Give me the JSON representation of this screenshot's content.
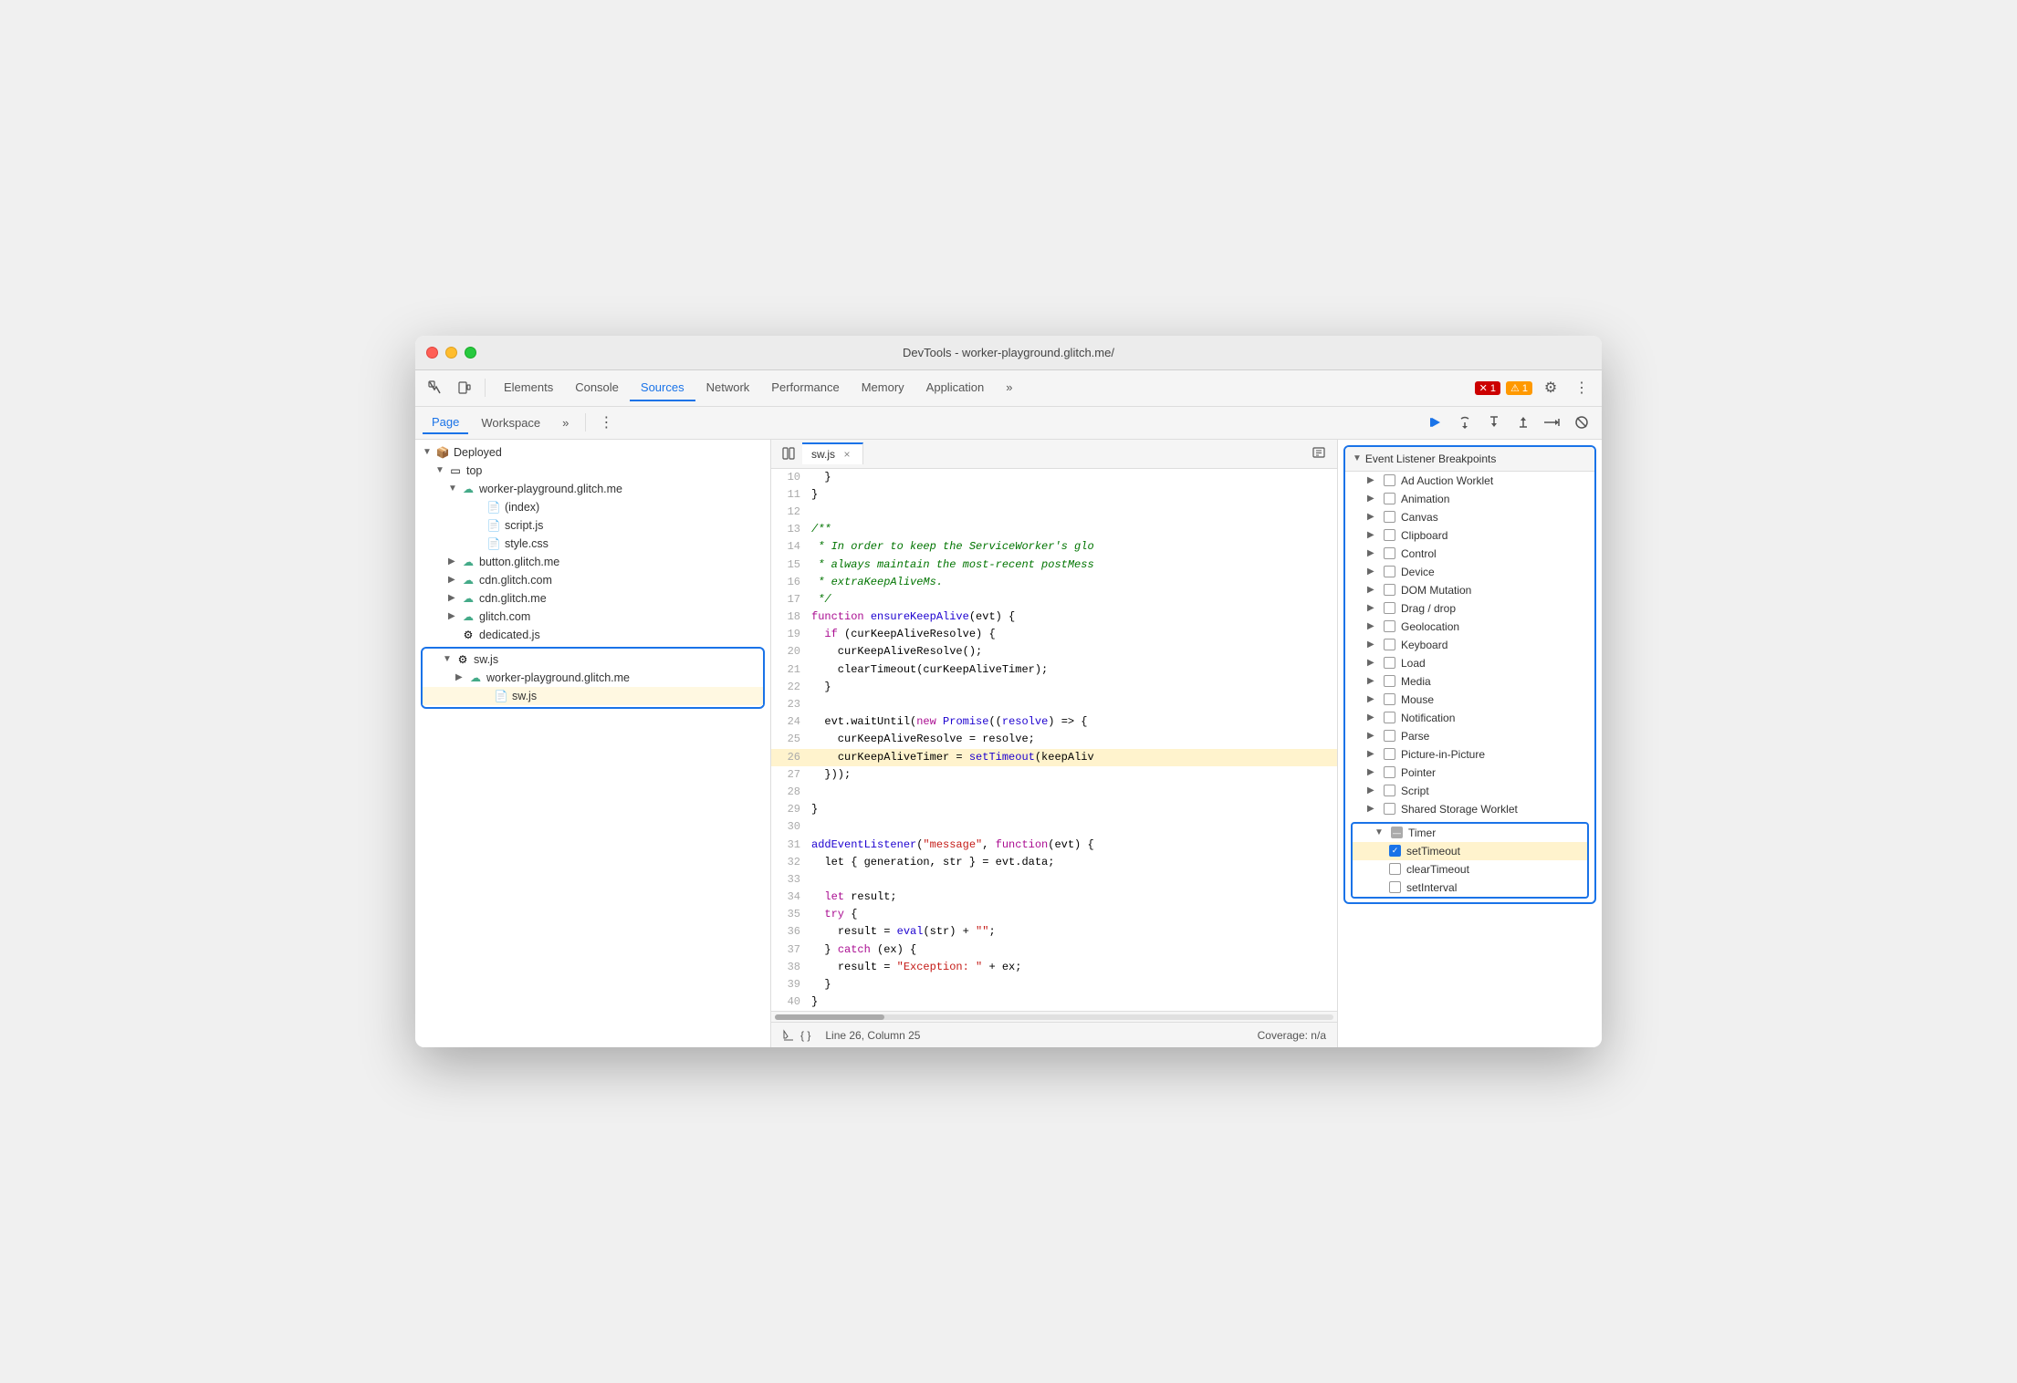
{
  "window": {
    "title": "DevTools - worker-playground.glitch.me/"
  },
  "toolbar": {
    "tabs": [
      {
        "label": "Elements",
        "active": false
      },
      {
        "label": "Console",
        "active": false
      },
      {
        "label": "Sources",
        "active": true
      },
      {
        "label": "Network",
        "active": false
      },
      {
        "label": "Performance",
        "active": false
      },
      {
        "label": "Memory",
        "active": false
      },
      {
        "label": "Application",
        "active": false
      },
      {
        "label": "»",
        "active": false
      }
    ],
    "error_badge": "✕ 1",
    "warn_badge": "⚠ 1",
    "settings_icon": "⚙",
    "more_icon": "⋮"
  },
  "subtoolbar": {
    "page_tab": "Page",
    "workspace_tab": "Workspace",
    "more": "»",
    "debug_icons": [
      "▶",
      "↺",
      "↓",
      "↑",
      "→→",
      "⊘"
    ]
  },
  "file_tree": {
    "items": [
      {
        "label": "Deployed",
        "indent": 0,
        "icon": "package",
        "expanded": true,
        "type": "folder"
      },
      {
        "label": "top",
        "indent": 1,
        "icon": "frame",
        "expanded": true,
        "type": "folder"
      },
      {
        "label": "worker-playground.glitch.me",
        "indent": 2,
        "icon": "cloud",
        "expanded": true,
        "type": "folder"
      },
      {
        "label": "(index)",
        "indent": 3,
        "icon": "file",
        "type": "file"
      },
      {
        "label": "script.js",
        "indent": 3,
        "icon": "js",
        "type": "file"
      },
      {
        "label": "style.css",
        "indent": 3,
        "icon": "css",
        "type": "file"
      },
      {
        "label": "button.glitch.me",
        "indent": 2,
        "icon": "cloud",
        "expanded": false,
        "type": "folder"
      },
      {
        "label": "cdn.glitch.com",
        "indent": 2,
        "icon": "cloud",
        "expanded": false,
        "type": "folder"
      },
      {
        "label": "cdn.glitch.me",
        "indent": 2,
        "icon": "cloud",
        "expanded": false,
        "type": "folder"
      },
      {
        "label": "glitch.com",
        "indent": 2,
        "icon": "cloud",
        "expanded": false,
        "type": "folder"
      },
      {
        "label": "dedicated.js",
        "indent": 2,
        "icon": "gear-file",
        "type": "file"
      },
      {
        "label": "sw.js",
        "indent": 1,
        "icon": "gear",
        "expanded": true,
        "type": "selected-group-start",
        "selected": true
      },
      {
        "label": "worker-playground.glitch.me",
        "indent": 2,
        "icon": "cloud",
        "expanded": false,
        "type": "folder",
        "selected": true
      },
      {
        "label": "sw.js",
        "indent": 3,
        "icon": "js-orange",
        "type": "file",
        "selected": true,
        "selected-group-end": true
      }
    ]
  },
  "code": {
    "filename": "sw.js",
    "lines": [
      {
        "num": 10,
        "code": "  }"
      },
      {
        "num": 11,
        "code": "}"
      },
      {
        "num": 12,
        "code": ""
      },
      {
        "num": 13,
        "code": "/**",
        "type": "comment"
      },
      {
        "num": 14,
        "code": " * In order to keep the ServiceWorker's glo",
        "type": "comment"
      },
      {
        "num": 15,
        "code": " * always maintain the most-recent postMess",
        "type": "comment"
      },
      {
        "num": 16,
        "code": " * extraKeepAliveMs.",
        "type": "comment"
      },
      {
        "num": 17,
        "code": " */",
        "type": "comment"
      },
      {
        "num": 18,
        "code": "function ensureKeepAlive(evt) {"
      },
      {
        "num": 19,
        "code": "  if (curKeepAliveResolve) {"
      },
      {
        "num": 20,
        "code": "    curKeepAliveResolve();"
      },
      {
        "num": 21,
        "code": "    clearTimeout(curKeepAliveTimer);"
      },
      {
        "num": 22,
        "code": "  }"
      },
      {
        "num": 23,
        "code": ""
      },
      {
        "num": 24,
        "code": "  evt.waitUntil(new Promise((resolve) => {"
      },
      {
        "num": 25,
        "code": "    curKeepAliveResolve = resolve;"
      },
      {
        "num": 26,
        "code": "    curKeepAliveTimer = setTimeout(keepAliv",
        "highlighted": true
      },
      {
        "num": 27,
        "code": "  }));"
      },
      {
        "num": 28,
        "code": ""
      },
      {
        "num": 29,
        "code": "}"
      },
      {
        "num": 30,
        "code": ""
      },
      {
        "num": 31,
        "code": "addEventListener(\"message\", function(evt) {"
      },
      {
        "num": 32,
        "code": "  let { generation, str } = evt.data;"
      },
      {
        "num": 33,
        "code": ""
      },
      {
        "num": 34,
        "code": "  let result;"
      },
      {
        "num": 35,
        "code": "  try {"
      },
      {
        "num": 36,
        "code": "    result = eval(str) + \"\";"
      },
      {
        "num": 37,
        "code": "  } catch (ex) {"
      },
      {
        "num": 38,
        "code": "    result = \"Exception: \" + ex;"
      },
      {
        "num": 39,
        "code": "  }"
      },
      {
        "num": 40,
        "code": "}"
      }
    ],
    "status": "Line 26, Column 25",
    "coverage": "Coverage: n/a"
  },
  "breakpoints": {
    "section_label": "Event Listener Breakpoints",
    "items": [
      {
        "label": "Ad Auction Worklet",
        "checked": false,
        "expandable": true
      },
      {
        "label": "Animation",
        "checked": false,
        "expandable": true
      },
      {
        "label": "Canvas",
        "checked": false,
        "expandable": true
      },
      {
        "label": "Clipboard",
        "checked": false,
        "expandable": true
      },
      {
        "label": "Control",
        "checked": false,
        "expandable": true
      },
      {
        "label": "Device",
        "checked": false,
        "expandable": true
      },
      {
        "label": "DOM Mutation",
        "checked": false,
        "expandable": true
      },
      {
        "label": "Drag / drop",
        "checked": false,
        "expandable": true
      },
      {
        "label": "Geolocation",
        "checked": false,
        "expandable": true
      },
      {
        "label": "Keyboard",
        "checked": false,
        "expandable": true
      },
      {
        "label": "Load",
        "checked": false,
        "expandable": true
      },
      {
        "label": "Media",
        "checked": false,
        "expandable": true
      },
      {
        "label": "Mouse",
        "checked": false,
        "expandable": true
      },
      {
        "label": "Notification",
        "checked": false,
        "expandable": true
      },
      {
        "label": "Parse",
        "checked": false,
        "expandable": true
      },
      {
        "label": "Picture-in-Picture",
        "checked": false,
        "expandable": true
      },
      {
        "label": "Pointer",
        "checked": false,
        "expandable": true
      },
      {
        "label": "Script",
        "checked": false,
        "expandable": true
      },
      {
        "label": "Shared Storage Worklet",
        "checked": false,
        "expandable": true
      }
    ],
    "timer": {
      "label": "Timer",
      "expanded": true,
      "sub_items": [
        {
          "label": "setTimeout",
          "checked": true,
          "highlighted": true
        },
        {
          "label": "clearTimeout",
          "checked": false
        },
        {
          "label": "setInterval",
          "checked": false
        }
      ]
    }
  }
}
